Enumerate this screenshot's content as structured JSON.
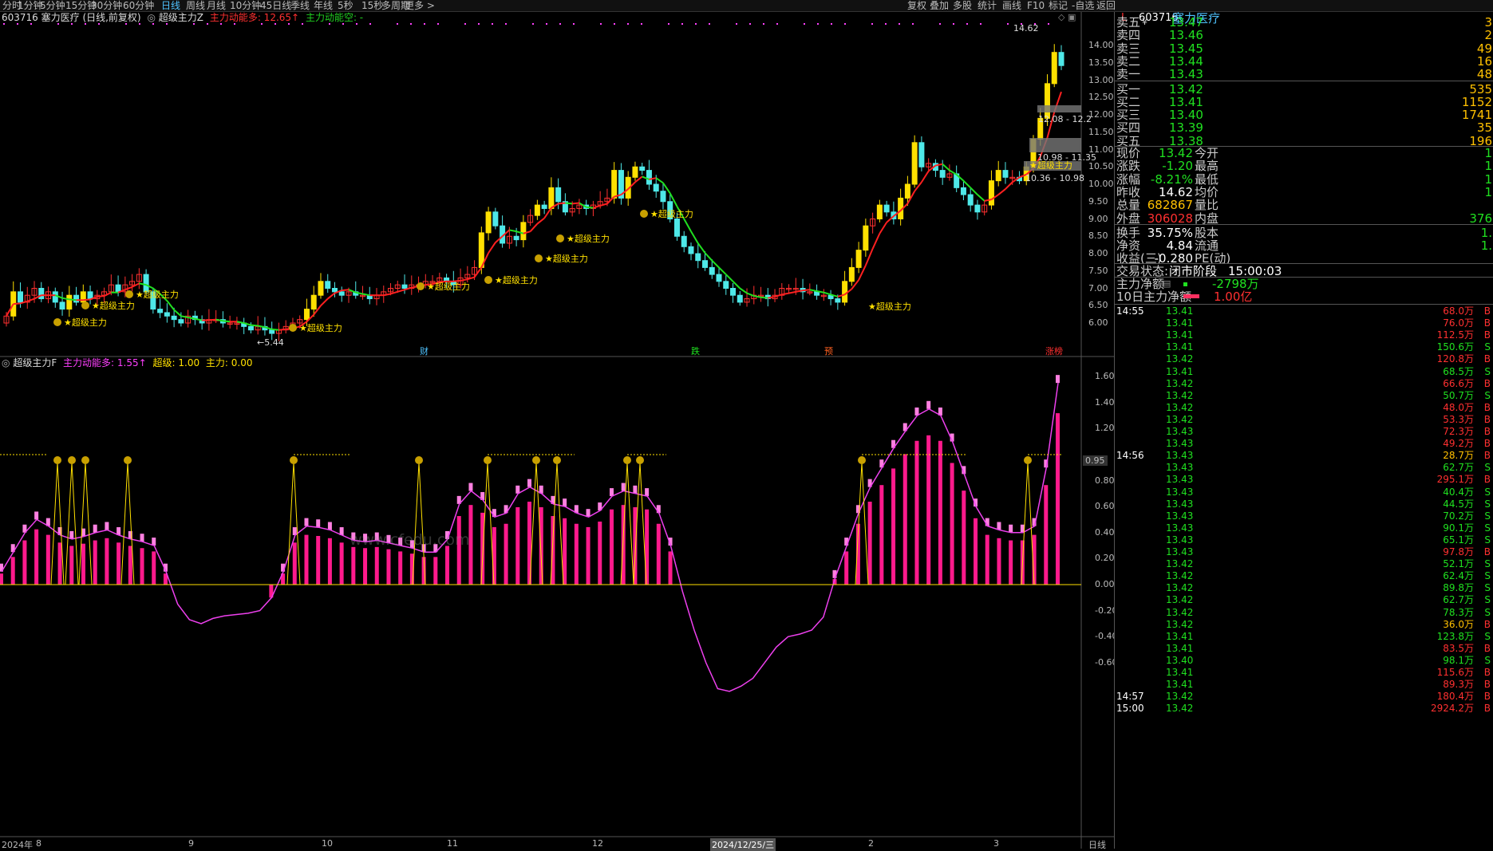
{
  "toolbar": {
    "left_items": [
      "分时",
      "1分钟",
      "5分钟",
      "15分钟",
      "30分钟",
      "60分钟",
      "日线",
      "周线",
      "月线",
      "10分钟",
      "45日线",
      "季线",
      "年线",
      "5秒",
      "15秒",
      "多周期",
      "更多 >"
    ],
    "active_index": 6,
    "right_items": [
      "复权",
      "叠加",
      "多股",
      "统计",
      "画线",
      "F10",
      "标记",
      "-自选",
      "返回"
    ]
  },
  "main_header": {
    "stock_line": "603716 塞力医疗 (日线,前复权)",
    "indicator_name": "超级主力Z",
    "dyn_long": "主力动能多: 12.65↑",
    "dyn_short": "主力动能空: -"
  },
  "sub_header": {
    "indicator_name": "超级主力F",
    "dyn_long": "主力动能多: 1.55↑",
    "super_val": "超级: 1.00",
    "main_val": "主力: 0.00"
  },
  "main_axis": [
    "14.00",
    "13.50",
    "13.00",
    "12.50",
    "12.00",
    "11.50",
    "11.00",
    "10.50",
    "10.00",
    "9.50",
    "9.00",
    "8.50",
    "8.00",
    "7.50",
    "7.00",
    "6.50",
    "6.00"
  ],
  "sub_axis": [
    "1.60",
    "1.40",
    "1.20",
    "0.95",
    "0.80",
    "0.60",
    "0.40",
    "0.20",
    "0.00",
    "-0.20",
    "-0.40",
    "-0.60"
  ],
  "x_labels": [
    "2024年",
    "8",
    "9",
    "10",
    "11",
    "12",
    "2024/12/25/三",
    "2",
    "3"
  ],
  "x_right_label": "日线",
  "annotations": {
    "high": "14.62",
    "low": "5.44",
    "zone1": "12.08 - 12.2",
    "zone2": "10.98 - 11.35",
    "zone3": "10.36 - 10.98",
    "signal_label": "★超级主力",
    "watermark": "www.cfedu.com",
    "event_tags": [
      "财",
      "跌",
      "预",
      "涨榜"
    ]
  },
  "stock": {
    "code": "603716",
    "name": "塞力医疗",
    "indicator_l": "L"
  },
  "order_book": {
    "sell": [
      {
        "label": "卖五",
        "price": "13.47",
        "vol": "3"
      },
      {
        "label": "卖四",
        "price": "13.46",
        "vol": "2"
      },
      {
        "label": "卖三",
        "price": "13.45",
        "vol": "49"
      },
      {
        "label": "卖二",
        "price": "13.44",
        "vol": "16"
      },
      {
        "label": "卖一",
        "price": "13.43",
        "vol": "48"
      }
    ],
    "buy": [
      {
        "label": "买一",
        "price": "13.42",
        "vol": "535"
      },
      {
        "label": "买二",
        "price": "13.41",
        "vol": "1152"
      },
      {
        "label": "买三",
        "price": "13.40",
        "vol": "1741"
      },
      {
        "label": "买四",
        "price": "13.39",
        "vol": "35"
      },
      {
        "label": "买五",
        "price": "13.38",
        "vol": "196"
      }
    ],
    "yen_mark": "¥"
  },
  "quote": [
    {
      "l": "现价",
      "v": "13.42",
      "l2": "今开",
      "v2": "1"
    },
    {
      "l": "涨跌",
      "v": "-1.20",
      "l2": "最高",
      "v2": "1"
    },
    {
      "l": "涨幅",
      "v": "-8.21%",
      "l2": "最低",
      "v2": "1"
    },
    {
      "l": "昨收",
      "v": "14.62",
      "l2": "均价",
      "v2": "1"
    },
    {
      "l": "总量",
      "v": "682867",
      "l2": "量比",
      "v2": ""
    },
    {
      "l": "外盘",
      "v": "306028",
      "l2": "内盘",
      "v2": "376"
    },
    {
      "l": "换手",
      "v": "35.75%",
      "l2": "股本",
      "v2": "1."
    },
    {
      "l": "净资",
      "v": "4.84",
      "l2": "流通",
      "v2": "1."
    },
    {
      "l": "收益(三)",
      "v": "-0.280",
      "l2": "PE(动)",
      "v2": ""
    }
  ],
  "trade_status": {
    "label": "交易状态:",
    "value": "闭市阶段",
    "time": "15:00:03"
  },
  "net_flow": [
    {
      "label": "主力净额",
      "value": "-2798万"
    },
    {
      "label": "10日主力净额",
      "value": "1.00亿"
    }
  ],
  "ticks": [
    {
      "time": "14:55",
      "price": "13.41",
      "vol": "68.0万",
      "side": "B"
    },
    {
      "time": "",
      "price": "13.41",
      "vol": "76.0万",
      "side": "B"
    },
    {
      "time": "",
      "price": "13.41",
      "vol": "112.5万",
      "side": "B"
    },
    {
      "time": "",
      "price": "13.41",
      "vol": "150.6万",
      "side": "S"
    },
    {
      "time": "",
      "price": "13.42",
      "vol": "120.8万",
      "side": "B"
    },
    {
      "time": "",
      "price": "13.41",
      "vol": "68.5万",
      "side": "S"
    },
    {
      "time": "",
      "price": "13.42",
      "vol": "66.6万",
      "side": "B"
    },
    {
      "time": "",
      "price": "13.42",
      "vol": "50.7万",
      "side": "S"
    },
    {
      "time": "",
      "price": "13.42",
      "vol": "48.0万",
      "side": "B"
    },
    {
      "time": "",
      "price": "13.42",
      "vol": "53.3万",
      "side": "B"
    },
    {
      "time": "",
      "price": "13.43",
      "vol": "72.3万",
      "side": "B"
    },
    {
      "time": "",
      "price": "13.43",
      "vol": "49.2万",
      "side": "B"
    },
    {
      "time": "14:56",
      "price": "13.43",
      "vol": "28.7万",
      "side": "B"
    },
    {
      "time": "",
      "price": "13.43",
      "vol": "62.7万",
      "side": "S"
    },
    {
      "time": "",
      "price": "13.43",
      "vol": "295.1万",
      "side": "B"
    },
    {
      "time": "",
      "price": "13.43",
      "vol": "40.4万",
      "side": "S"
    },
    {
      "time": "",
      "price": "13.43",
      "vol": "44.5万",
      "side": "S"
    },
    {
      "time": "",
      "price": "13.43",
      "vol": "70.2万",
      "side": "S"
    },
    {
      "time": "",
      "price": "13.43",
      "vol": "90.1万",
      "side": "S"
    },
    {
      "time": "",
      "price": "13.43",
      "vol": "65.1万",
      "side": "S"
    },
    {
      "time": "",
      "price": "13.43",
      "vol": "97.8万",
      "side": "B"
    },
    {
      "time": "",
      "price": "13.42",
      "vol": "52.1万",
      "side": "S"
    },
    {
      "time": "",
      "price": "13.42",
      "vol": "62.4万",
      "side": "S"
    },
    {
      "time": "",
      "price": "13.42",
      "vol": "89.8万",
      "side": "S"
    },
    {
      "time": "",
      "price": "13.42",
      "vol": "62.7万",
      "side": "S"
    },
    {
      "time": "",
      "price": "13.42",
      "vol": "78.3万",
      "side": "S"
    },
    {
      "time": "",
      "price": "13.42",
      "vol": "36.0万",
      "side": "B"
    },
    {
      "time": "",
      "price": "13.41",
      "vol": "123.8万",
      "side": "S"
    },
    {
      "time": "",
      "price": "13.41",
      "vol": "83.5万",
      "side": "B"
    },
    {
      "time": "",
      "price": "13.40",
      "vol": "98.1万",
      "side": "S"
    },
    {
      "time": "",
      "price": "13.41",
      "vol": "115.6万",
      "side": "B"
    },
    {
      "time": "",
      "price": "13.41",
      "vol": "89.3万",
      "side": "B"
    },
    {
      "time": "14:57",
      "price": "13.42",
      "vol": "180.4万",
      "side": "B"
    },
    {
      "time": "15:00",
      "price": "13.42",
      "vol": "2924.2万",
      "side": "B"
    }
  ],
  "chart_data": [
    {
      "type": "candlestick",
      "title": "超级主力Z",
      "ylim": [
        5.44,
        14.62
      ],
      "y_ticks": [
        6.0,
        6.5,
        7.0,
        7.5,
        8.0,
        8.5,
        9.0,
        9.5,
        10.0,
        10.5,
        11.0,
        11.5,
        12.0,
        12.5,
        13.0,
        13.5,
        14.0
      ],
      "close": [
        6.2,
        6.9,
        6.6,
        6.8,
        7.0,
        6.7,
        6.9,
        6.6,
        6.4,
        6.8,
        6.6,
        6.9,
        6.7,
        6.8,
        6.9,
        7.1,
        6.9,
        7.1,
        7.2,
        7.4,
        6.9,
        6.4,
        6.3,
        6.2,
        6.1,
        6.0,
        6.2,
        6.1,
        6.0,
        6.1,
        6.1,
        6.0,
        6.0,
        6.0,
        5.9,
        5.8,
        5.9,
        5.8,
        5.7,
        5.8,
        5.9,
        6.0,
        6.1,
        6.4,
        6.8,
        7.2,
        7.0,
        6.9,
        6.8,
        6.9,
        6.8,
        6.8,
        6.7,
        6.8,
        6.9,
        7.0,
        7.1,
        7.0,
        7.1,
        7.1,
        7.2,
        7.2,
        7.3,
        7.2,
        7.1,
        7.3,
        7.4,
        7.6,
        8.6,
        9.2,
        8.8,
        8.3,
        8.5,
        8.4,
        8.9,
        9.1,
        9.4,
        9.3,
        9.9,
        9.5,
        9.2,
        9.3,
        9.4,
        9.3,
        9.4,
        9.5,
        9.6,
        10.4,
        9.6,
        10.2,
        10.5,
        10.4,
        10.0,
        9.8,
        9.5,
        9.0,
        8.5,
        8.2,
        8.0,
        7.8,
        7.6,
        7.4,
        7.2,
        7.0,
        6.8,
        6.6,
        6.7,
        6.8,
        6.8,
        6.7,
        6.8,
        7.0,
        7.0,
        7.0,
        6.9,
        6.9,
        6.8,
        6.8,
        6.7,
        6.6,
        7.2,
        7.6,
        8.1,
        8.8,
        9.0,
        9.4,
        9.2,
        9.0,
        9.6,
        10.0,
        11.2,
        10.5,
        10.6,
        10.4,
        10.2,
        10.3,
        9.9,
        9.7,
        9.4,
        9.2,
        9.4,
        10.1,
        10.4,
        10.2,
        10.2,
        10.1,
        10.5,
        11.3,
        11.9,
        12.9,
        13.8,
        13.42
      ],
      "sub_chart": {
        "title": "超级主力F",
        "ylim": [
          -0.8,
          1.7
        ],
        "y_ticks": [
          -0.6,
          -0.4,
          -0.2,
          0.0,
          0.2,
          0.4,
          0.6,
          0.8,
          0.95,
          1.2,
          1.4,
          1.6
        ],
        "power_line": [
          0.1,
          0.25,
          0.4,
          0.5,
          0.45,
          0.38,
          0.35,
          0.37,
          0.4,
          0.42,
          0.38,
          0.35,
          0.33,
          0.3,
          0.1,
          -0.15,
          -0.27,
          -0.3,
          -0.26,
          -0.24,
          -0.23,
          -0.22,
          -0.2,
          -0.1,
          0.1,
          0.38,
          0.45,
          0.44,
          0.42,
          0.38,
          0.34,
          0.33,
          0.34,
          0.32,
          0.3,
          0.28,
          0.25,
          0.25,
          0.35,
          0.62,
          0.72,
          0.65,
          0.52,
          0.55,
          0.7,
          0.75,
          0.7,
          0.62,
          0.6,
          0.55,
          0.52,
          0.57,
          0.68,
          0.72,
          0.7,
          0.68,
          0.55,
          0.3,
          -0.05,
          -0.35,
          -0.6,
          -0.8,
          -0.82,
          -0.78,
          -0.72,
          -0.6,
          -0.48,
          -0.4,
          -0.38,
          -0.35,
          -0.25,
          0.05,
          0.3,
          0.55,
          0.75,
          0.9,
          1.05,
          1.18,
          1.3,
          1.35,
          1.3,
          1.1,
          0.85,
          0.6,
          0.45,
          0.42,
          0.4,
          0.4,
          0.45,
          0.9,
          1.55
        ]
      }
    }
  ]
}
